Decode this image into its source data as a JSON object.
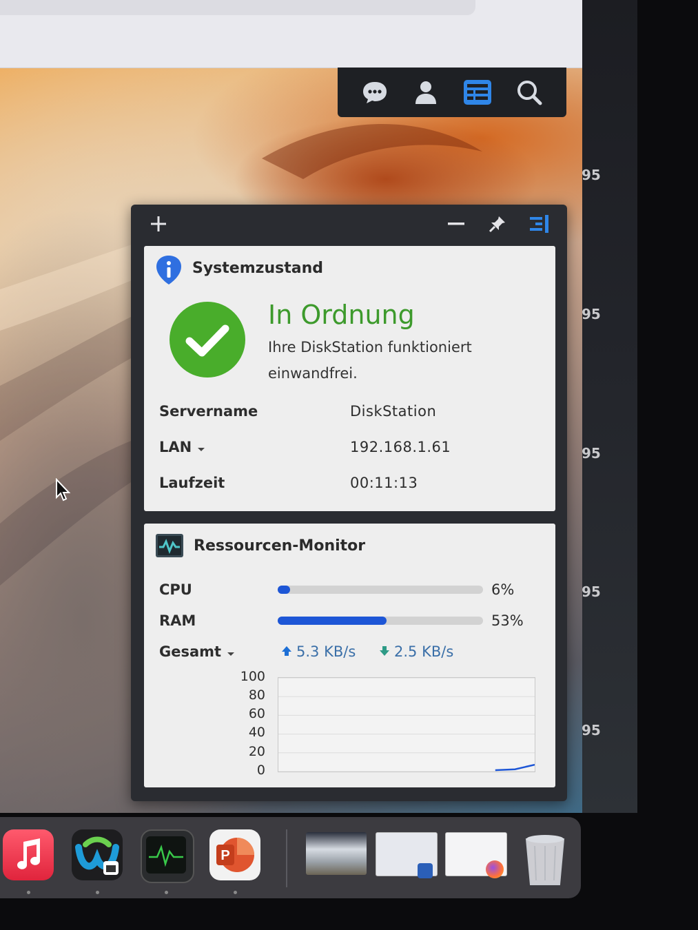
{
  "widgets": {
    "system_health": {
      "title": "Systemzustand",
      "status": "In Ordnung",
      "description": "Ihre DiskStation funktioniert einwandfrei.",
      "rows": [
        {
          "label": "Servername",
          "value": "DiskStation"
        },
        {
          "label": "LAN",
          "value": "192.168.1.61"
        },
        {
          "label": "Laufzeit",
          "value": "00:11:13"
        }
      ]
    },
    "resource_monitor": {
      "title": "Ressourcen-Monitor",
      "cpu": {
        "label": "CPU",
        "percent_text": "6%",
        "fraction": 0.06
      },
      "ram": {
        "label": "RAM",
        "percent_text": "53%",
        "fraction": 0.53
      },
      "network": {
        "label": "Gesamt",
        "upload": "5.3 KB/s",
        "download": "2.5 KB/s"
      },
      "chart_data": {
        "type": "line",
        "y_ticks": [
          "100",
          "80",
          "60",
          "40",
          "20",
          "0"
        ],
        "ylim": [
          0,
          100
        ],
        "series": [
          {
            "values": [
              0,
              0,
              0,
              0,
              0,
              0,
              0,
              0,
              0,
              0,
              0,
              0,
              1,
              6
            ]
          }
        ]
      }
    }
  },
  "right_strip_numbers": [
    "95",
    "95",
    "95",
    "95",
    "95"
  ],
  "colors": {
    "ok_green": "#3d9a2c",
    "bar_blue": "#1d56d6",
    "net_blue": "#3a6fa8",
    "info_blue": "#2f6fe0"
  },
  "toolbar_icons": [
    "chat-icon",
    "user-icon",
    "widgets-icon",
    "search-icon"
  ],
  "panel_icons": [
    "add-icon",
    "minimize-icon",
    "pin-icon",
    "panel-toggle-icon"
  ],
  "dock_apps": [
    "music",
    "webex",
    "activity-monitor",
    "powerpoint",
    "window-photo",
    "window-word",
    "window-firefox",
    "trash"
  ]
}
